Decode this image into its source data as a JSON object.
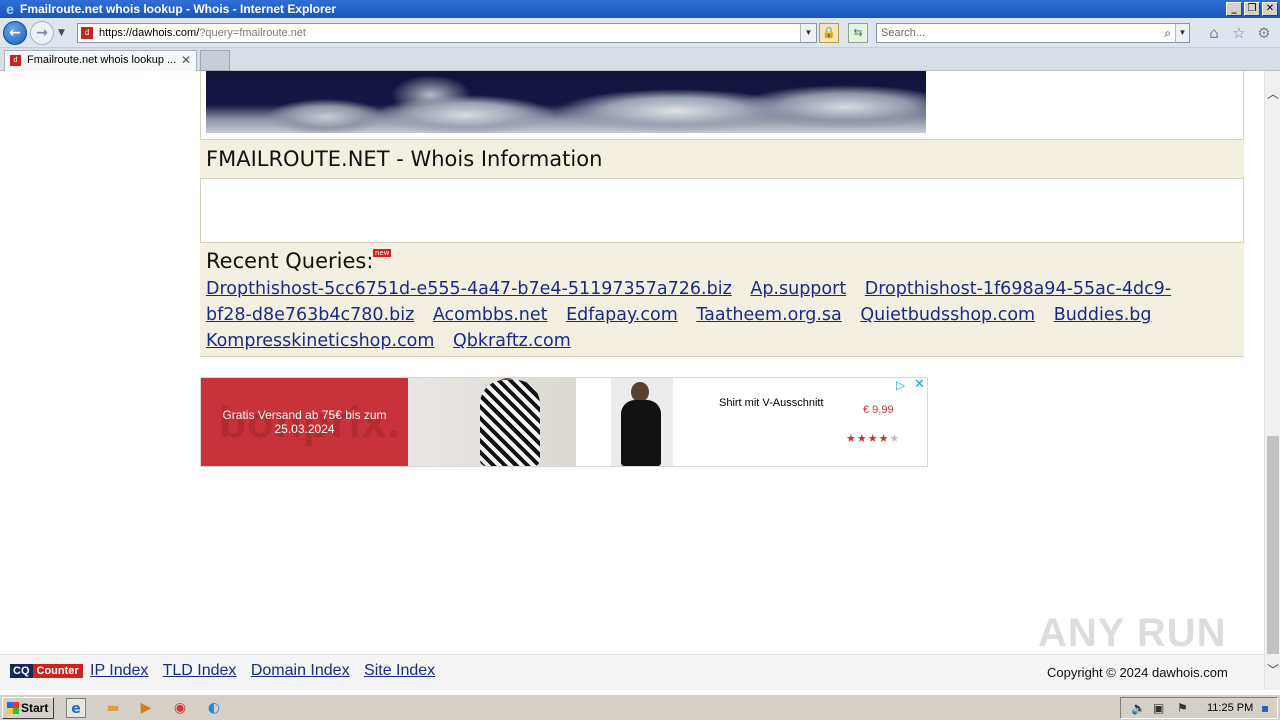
{
  "window": {
    "title": "Fmailroute.net whois lookup - Whois - Internet Explorer",
    "controls": [
      "_",
      "❐",
      "✕"
    ]
  },
  "addressbar": {
    "url_host": "https://dawhois.com/",
    "url_path": "?query=fmailroute.net",
    "search_placeholder": "Search..."
  },
  "tabs": [
    {
      "label": "Fmailroute.net whois lookup ...",
      "close": "✕"
    }
  ],
  "page": {
    "whois_title": "FMAILROUTE.NET - Whois Information",
    "recent_title": "Recent Queries:",
    "new_badge": "new",
    "recent_links": [
      "Dropthishost-5cc6751d-e555-4a47-b7e4-51197357a726.biz",
      "Ap.support",
      "Dropthishost-1f698a94-55ac-4dc9-bf28-d8e763b4c780.biz",
      "Acombbs.net",
      "Edfapay.com",
      "Taatheem.org.sa",
      "Quietbudsshop.com",
      "Buddies.bg",
      "Kompresskineticshop.com",
      "Qbkraftz.com"
    ]
  },
  "ad": {
    "ghost_logo": "bonprix.",
    "promo": "Gratis Versand ab 75€ bis zum 25.03.2024",
    "product": "Shirt mit V-Ausschnitt",
    "price": "€ 9,99",
    "rating": 4,
    "rating_max": 5,
    "accent": "#c8323a"
  },
  "footer": {
    "cq_a": "CQ",
    "cq_b": "Counter",
    "links": [
      "IP Index",
      "TLD Index",
      "Domain Index",
      "Site Index"
    ],
    "copyright": "Copyright © 2024 dawhois.com",
    "watermark": "ANY RUN"
  },
  "taskbar": {
    "start_label": "Start",
    "clock": "11:25 PM",
    "pinned_icons": [
      "ie-icon",
      "folder-icon",
      "media-player-icon",
      "chrome-icon",
      "edge-icon"
    ]
  }
}
